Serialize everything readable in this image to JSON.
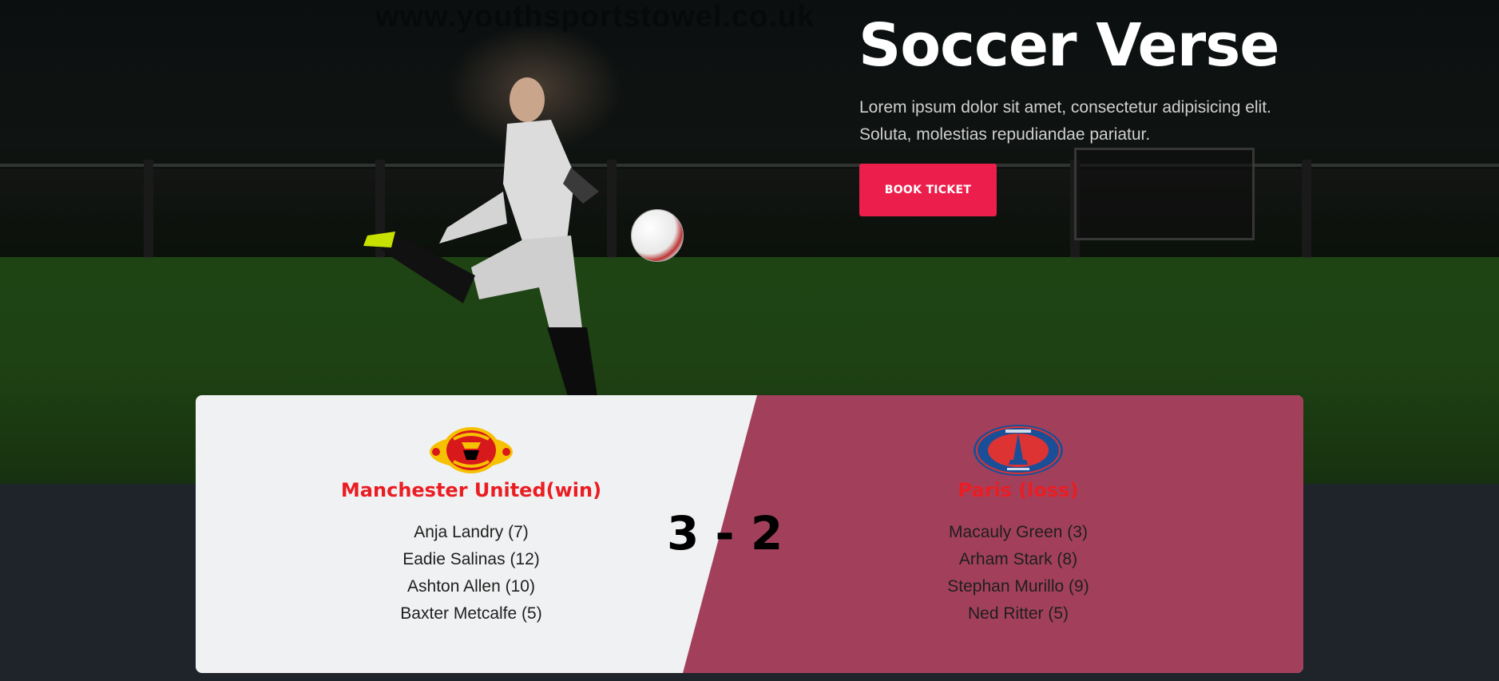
{
  "hero": {
    "watermark": "www.youthsportstowel.co.uk",
    "title": "Soccer Verse",
    "subtitle": "Lorem ipsum dolor sit amet, consectetur adipisicing elit. Soluta, molestias repudiandae pariatur.",
    "cta_label": "BOOK TICKET"
  },
  "match": {
    "score": "3 - 2",
    "home": {
      "name": "Manchester United(win)",
      "logo_icon": "manchester-united-crest",
      "scorers": [
        "Anja Landry (7)",
        "Eadie Salinas (12)",
        "Ashton Allen (10)",
        "Baxter Metcalfe (5)"
      ]
    },
    "away": {
      "name": "Paris (loss)",
      "logo_icon": "psg-crest",
      "scorers": [
        "Macauly Green (3)",
        "Arham Stark (8)",
        "Stephan Murillo (9)",
        "Ned Ritter (5)"
      ]
    }
  },
  "colors": {
    "accent": "#ec1f4c",
    "team_name": "#ea1d23",
    "away_panel": "#a2405c",
    "home_panel": "#f0f1f2",
    "page_bg": "#1f232a"
  }
}
